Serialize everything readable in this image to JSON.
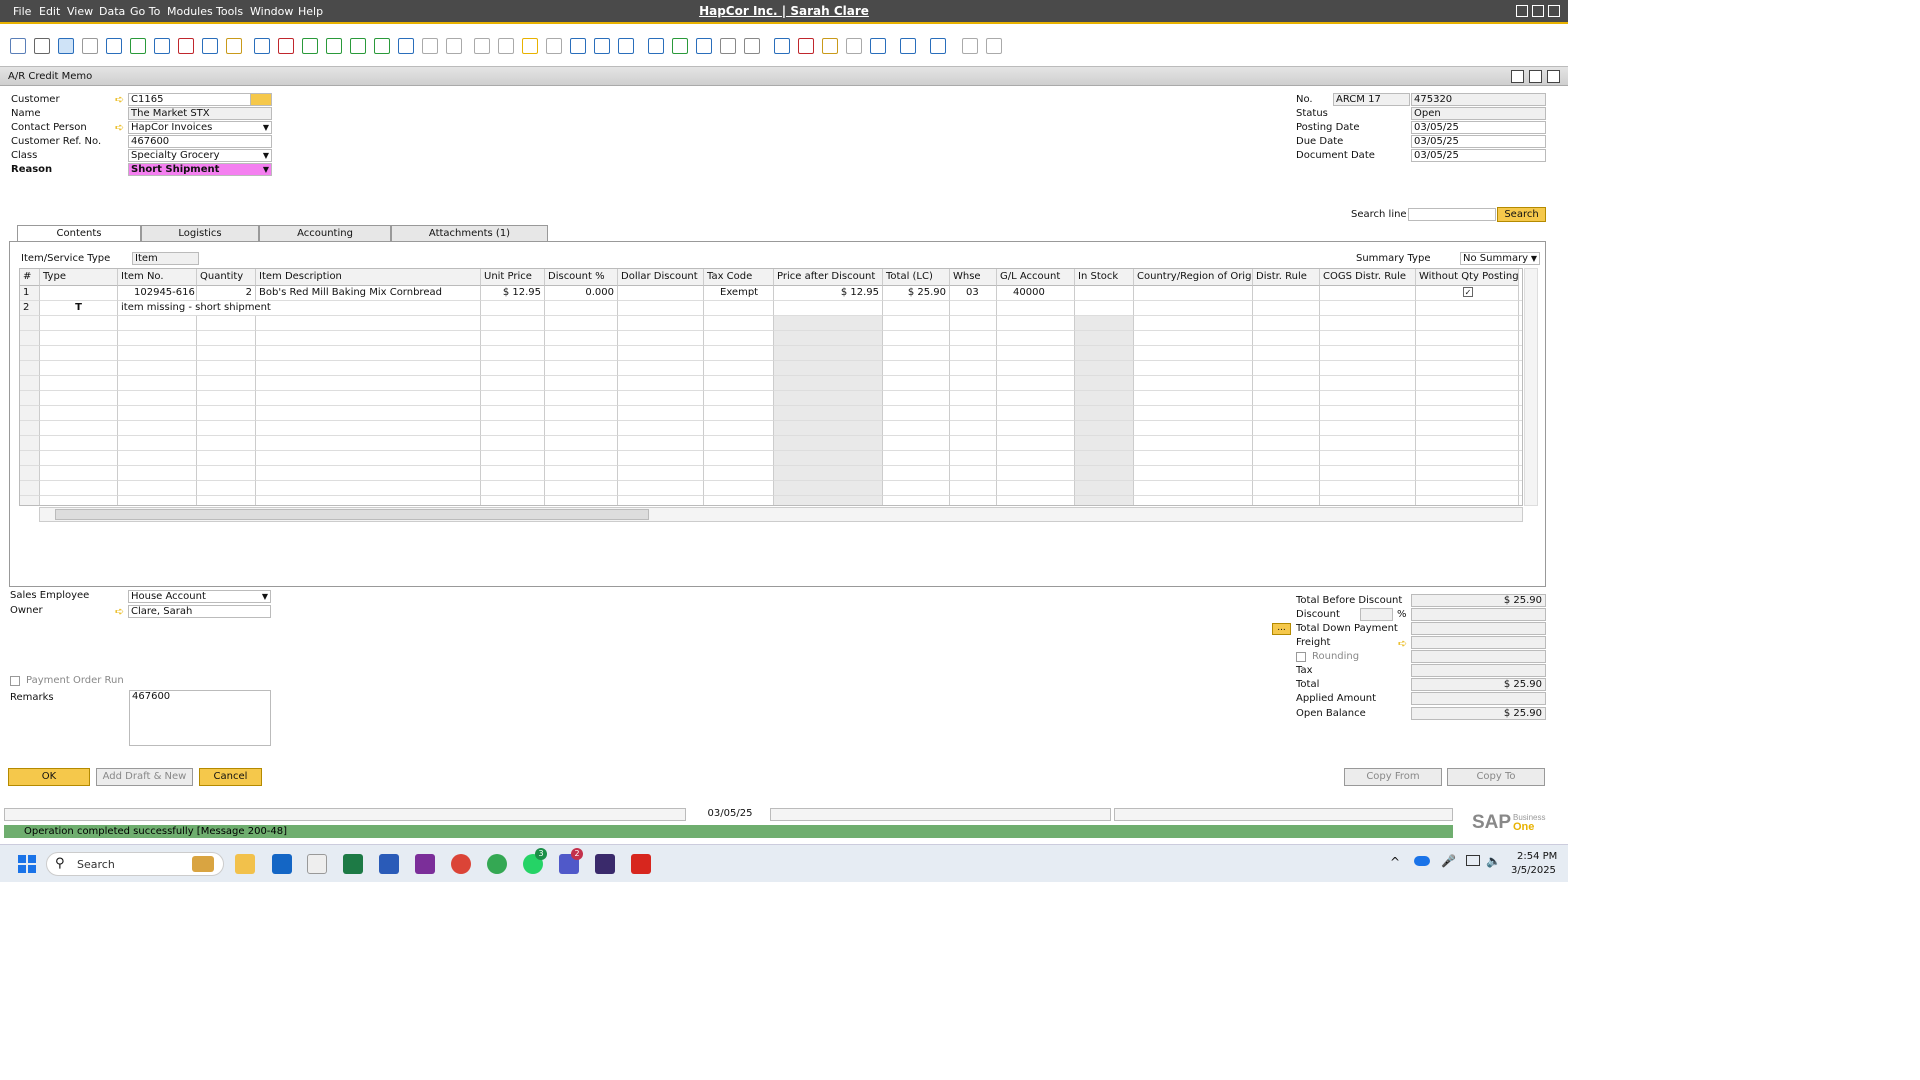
{
  "menu": [
    "File",
    "Edit",
    "View",
    "Data",
    "Go To",
    "Modules",
    "Tools",
    "Window",
    "Help"
  ],
  "app_title": "HapCor Inc. | Sarah Clare",
  "doc_title": "A/R Credit Memo",
  "header_left": {
    "customer_label": "Customer",
    "customer": "C1165",
    "name_label": "Name",
    "name": "The Market STX",
    "contact_label": "Contact Person",
    "contact": "HapCor Invoices",
    "ref_label": "Customer Ref. No.",
    "ref": "467600",
    "class_label": "Class",
    "class": "Specialty Grocery",
    "reason_label": "Reason",
    "reason": "Short Shipment"
  },
  "header_right": {
    "no_label": "No.",
    "series": "ARCM 17",
    "no": "475320",
    "status_label": "Status",
    "status": "Open",
    "posting_label": "Posting Date",
    "posting": "03/05/25",
    "due_label": "Due Date",
    "due": "03/05/25",
    "docdate_label": "Document Date",
    "docdate": "03/05/25"
  },
  "search": {
    "label": "Search line",
    "button": "Search"
  },
  "tabs": [
    "Contents",
    "Logistics",
    "Accounting",
    "Attachments (1)"
  ],
  "item_type": {
    "label": "Item/Service Type",
    "value": "Item"
  },
  "summary": {
    "label": "Summary Type",
    "value": "No Summary"
  },
  "columns": [
    "#",
    "Type",
    "Item No.",
    "Quantity",
    "Item Description",
    "Unit Price",
    "Discount %",
    "Dollar Discount",
    "Tax Code",
    "Price after Discount",
    "Total (LC)",
    "Whse",
    "G/L Account",
    "In Stock",
    "Country/Region of Origin",
    "Distr. Rule",
    "COGS Distr. Rule",
    "Without Qty Posting"
  ],
  "rows": [
    {
      "num": "1",
      "item": "102945-616",
      "qty": "2",
      "desc": "Bob's Red Mill Baking Mix Cornbread",
      "price": "$ 12.95",
      "disc": "0.000",
      "tax": "Exempt",
      "pad": "$ 12.95",
      "total": "$ 25.90",
      "whse": "03",
      "gl": "40000"
    },
    {
      "num": "2",
      "type": "T",
      "desc": "item missing - short shipment"
    }
  ],
  "footer_left": {
    "sales_label": "Sales Employee",
    "sales": "House Account",
    "owner_label": "Owner",
    "owner": "Clare, Sarah",
    "por_label": "Payment Order Run",
    "remarks_label": "Remarks",
    "remarks": "467600"
  },
  "totals": {
    "tbd_label": "Total Before Discount",
    "tbd": "$ 25.90",
    "disc_label": "Discount",
    "pct": "%",
    "tdp_label": "Total Down Payment",
    "freight_label": "Freight",
    "rounding_label": "Rounding",
    "tax_label": "Tax",
    "total_label": "Total",
    "total": "$ 25.90",
    "applied_label": "Applied Amount",
    "open_label": "Open Balance",
    "open": "$ 25.90",
    "dots": "..."
  },
  "buttons": {
    "ok": "OK",
    "draft": "Add Draft & New",
    "cancel": "Cancel",
    "copy_from": "Copy From",
    "copy_to": "Copy To"
  },
  "status_date": "03/05/25",
  "message": "Operation completed successfully  [Message 200-48]",
  "sap_logo": "SAP",
  "sap_sub1": "Business",
  "sap_sub2": "One",
  "taskbar": {
    "search": "Search",
    "time": "2:54 PM",
    "date": "3/5/2025",
    "badge1": "3",
    "badge2": "2"
  }
}
